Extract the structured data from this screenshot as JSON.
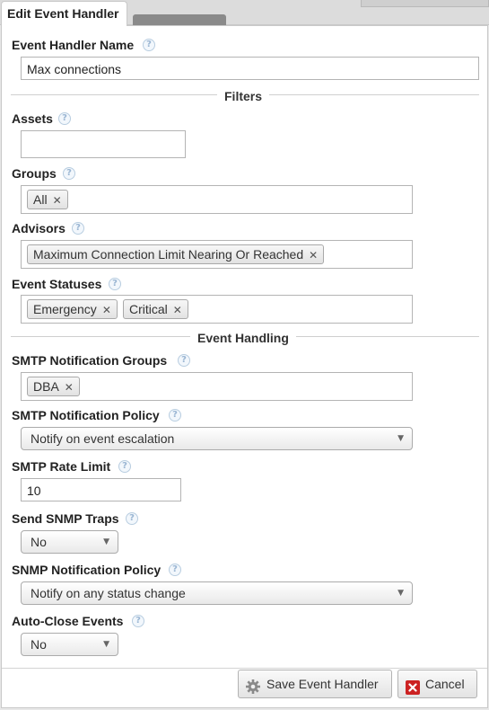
{
  "dialog": {
    "title": "Edit Event Handler"
  },
  "fields": {
    "name": {
      "label": "Event Handler Name",
      "value": "Max connections"
    },
    "assets": {
      "label": "Assets",
      "value": ""
    },
    "groups": {
      "label": "Groups",
      "chips": [
        "All"
      ]
    },
    "advisors": {
      "label": "Advisors",
      "chips": [
        "Maximum Connection Limit Nearing Or Reached"
      ]
    },
    "event_statuses": {
      "label": "Event Statuses",
      "chips": [
        "Emergency",
        "Critical"
      ]
    },
    "smtp_groups": {
      "label": "SMTP Notification Groups",
      "chips": [
        "DBA"
      ]
    },
    "smtp_policy": {
      "label": "SMTP Notification Policy",
      "value": "Notify on event escalation"
    },
    "smtp_rate": {
      "label": "SMTP Rate Limit",
      "value": "10"
    },
    "snmp_traps": {
      "label": "Send SNMP Traps",
      "value": "No"
    },
    "snmp_policy": {
      "label": "SNMP Notification Policy",
      "value": "Notify on any status change"
    },
    "auto_close": {
      "label": "Auto-Close Events",
      "value": "No"
    }
  },
  "sections": {
    "filters": "Filters",
    "event_handling": "Event Handling"
  },
  "help_glyph": "?",
  "remove_glyph": "✕",
  "caret_glyph": "▼",
  "buttons": {
    "save": "Save Event Handler",
    "cancel": "Cancel"
  },
  "icons": {
    "save": "gear-icon",
    "cancel": "cancel-x-icon"
  },
  "colors": {
    "cancel_icon": "#cc2222",
    "help_icon": "#9ab6d3"
  }
}
